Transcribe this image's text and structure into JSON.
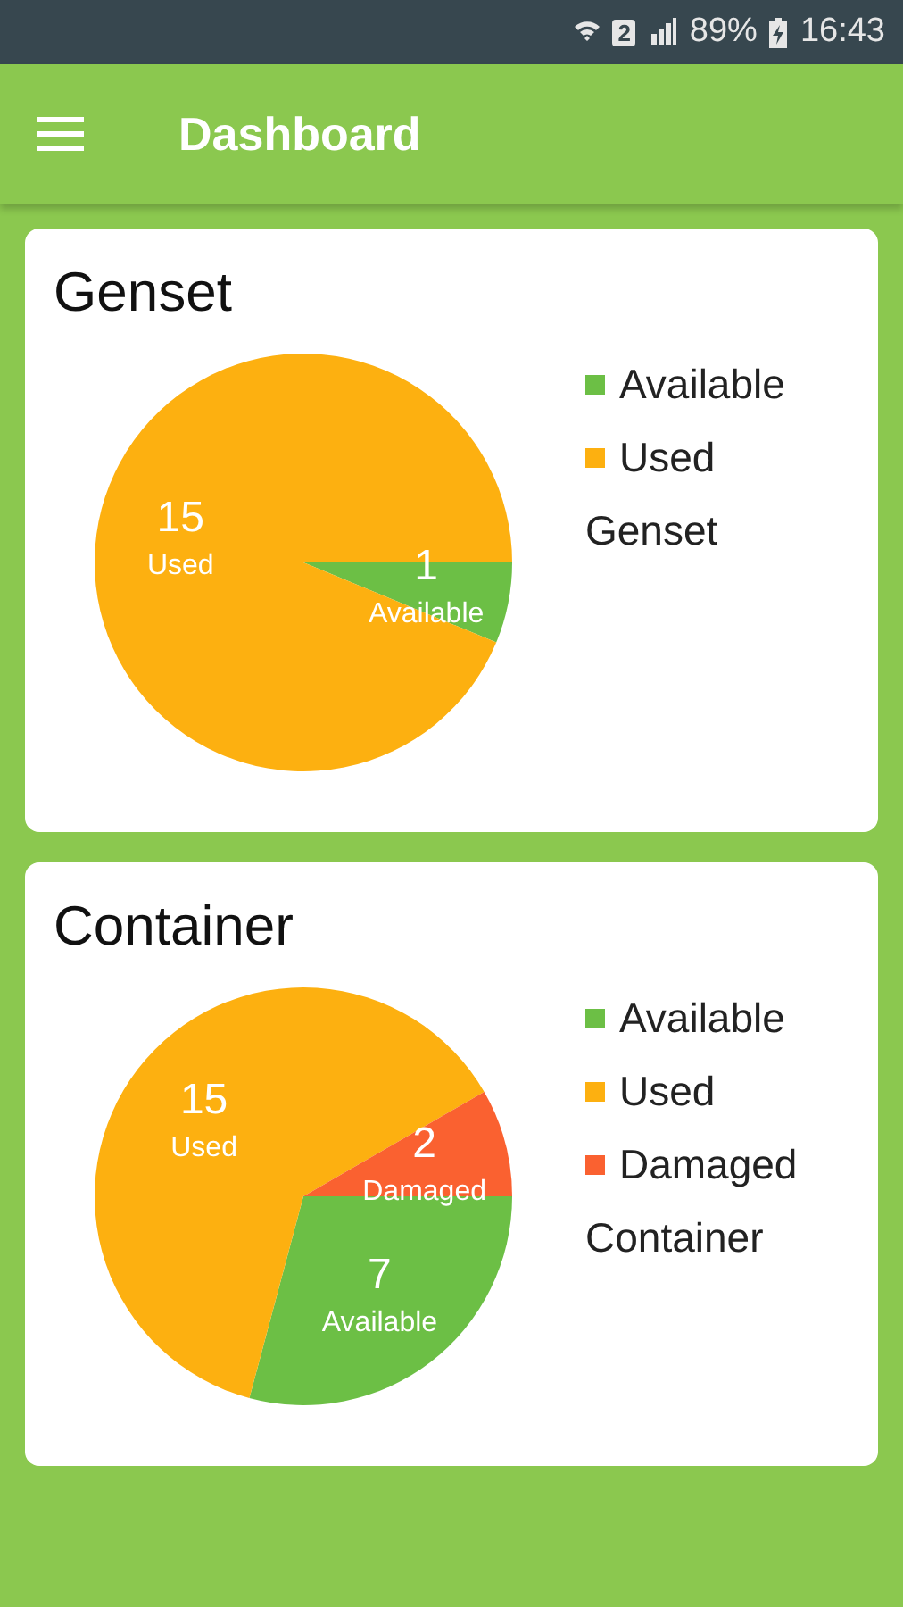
{
  "status_bar": {
    "sim": "2",
    "battery": "89%",
    "time": "16:43"
  },
  "app_bar": {
    "title": "Dashboard"
  },
  "cards": [
    {
      "title": "Genset",
      "chart_data": {
        "type": "pie",
        "data_labels": true,
        "categories": [
          "Available",
          "Used"
        ],
        "colors": [
          "#6cbf45",
          "#fdb010"
        ],
        "series": [
          {
            "name": "Genset",
            "values": [
              1,
              15
            ]
          }
        ]
      }
    },
    {
      "title": "Container",
      "chart_data": {
        "type": "pie",
        "data_labels": true,
        "categories": [
          "Available",
          "Used",
          "Damaged"
        ],
        "colors": [
          "#6cbf45",
          "#fdb010",
          "#fa6130"
        ],
        "series": [
          {
            "name": "Container",
            "values": [
              7,
              15,
              2
            ]
          }
        ]
      }
    }
  ]
}
